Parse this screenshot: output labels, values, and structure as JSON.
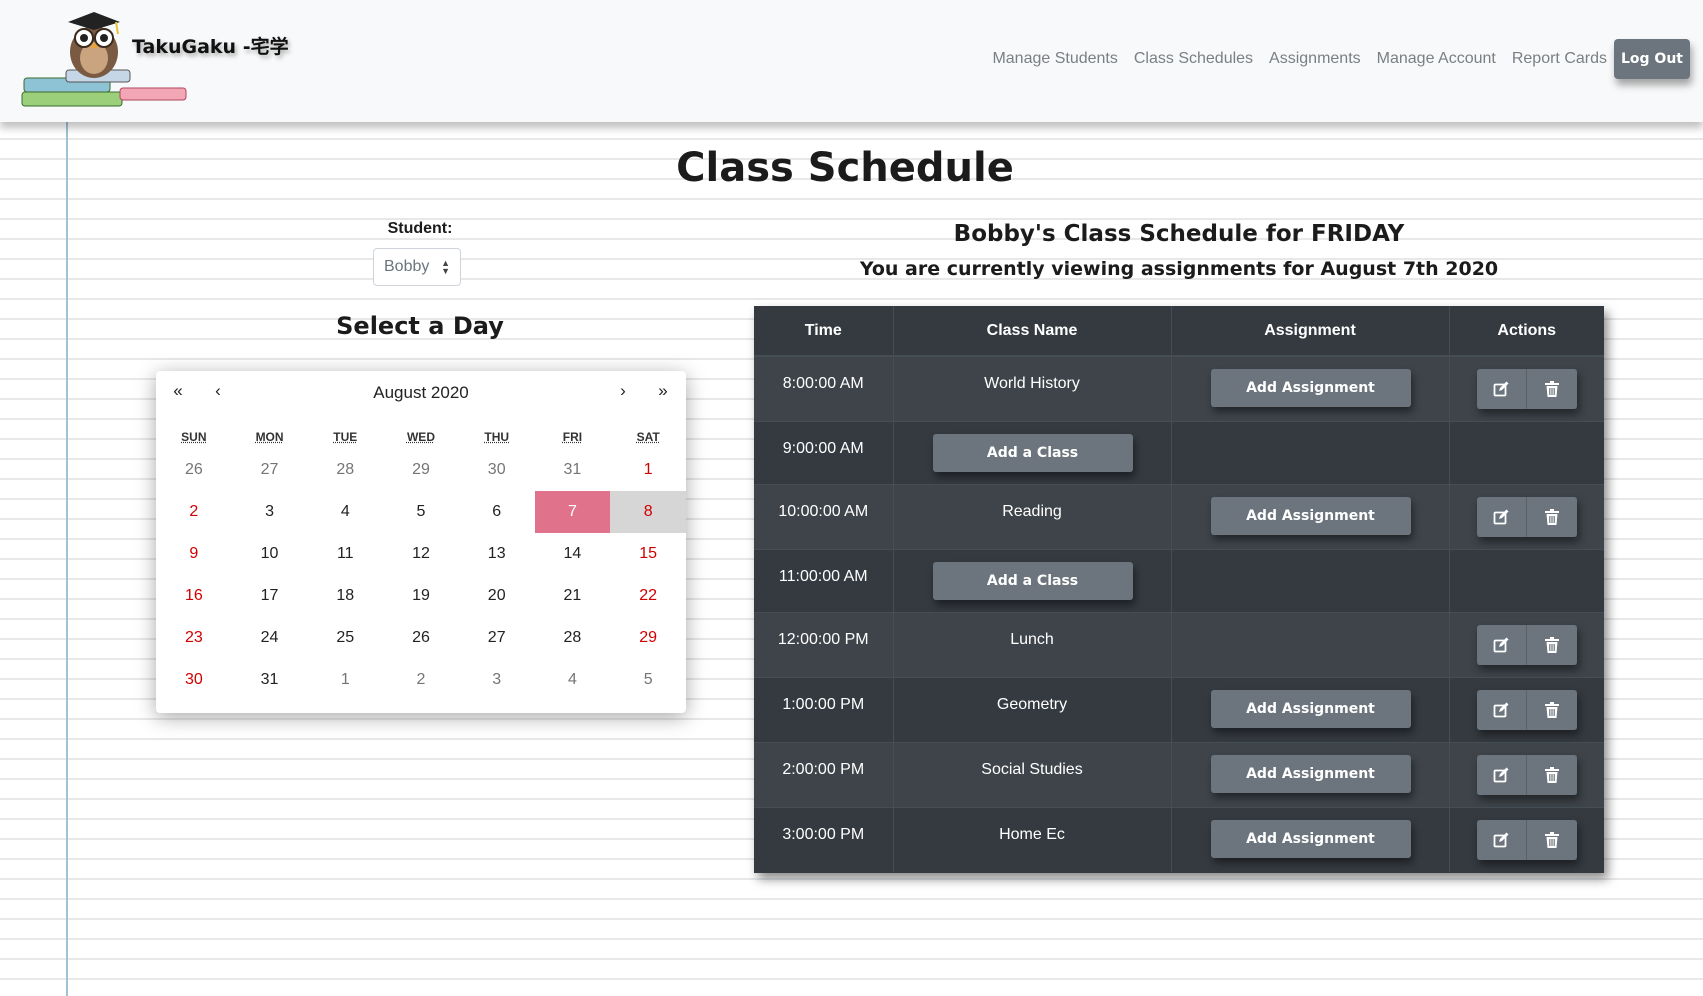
{
  "brand": {
    "name": "TakuGaku -宅学",
    "logo_alt": "owl-on-books-logo"
  },
  "nav": {
    "links": [
      "Manage Students",
      "Class Schedules",
      "Assignments",
      "Manage Account",
      "Report Cards"
    ],
    "logout": "Log Out"
  },
  "page": {
    "title": "Class Schedule",
    "student_label": "Student:",
    "student_selected": "Bobby",
    "select_day": "Select a Day",
    "schedule_heading": "Bobby's Class Schedule for FRIDAY",
    "schedule_subheading": "You are currently viewing assignments for August 7th 2020"
  },
  "calendar": {
    "nav": {
      "prev_year": "«",
      "prev_month": "‹",
      "next_month": "›",
      "next_year": "»"
    },
    "month_label": "August 2020",
    "weekdays": [
      "SUN",
      "MON",
      "TUE",
      "WED",
      "THU",
      "FRI",
      "SAT"
    ],
    "weeks": [
      [
        "26",
        "27",
        "28",
        "29",
        "30",
        "31",
        "1"
      ],
      [
        "2",
        "3",
        "4",
        "5",
        "6",
        "7",
        "8"
      ],
      [
        "9",
        "10",
        "11",
        "12",
        "13",
        "14",
        "15"
      ],
      [
        "16",
        "17",
        "18",
        "19",
        "20",
        "21",
        "22"
      ],
      [
        "23",
        "24",
        "25",
        "26",
        "27",
        "28",
        "29"
      ],
      [
        "30",
        "31",
        "1",
        "2",
        "3",
        "4",
        "5"
      ]
    ],
    "selected_day": "7",
    "colors": {
      "selected": "#e0728c",
      "weekend": "#d10000",
      "highlight": "#d6d6d6"
    }
  },
  "table": {
    "headers": [
      "Time",
      "Class Name",
      "Assignment",
      "Actions"
    ],
    "rows": [
      {
        "time": "8:00:00 AM",
        "class": "World History",
        "assignment_button": "Add Assignment",
        "actions": true
      },
      {
        "time": "9:00:00 AM",
        "class_button": "Add a Class"
      },
      {
        "time": "10:00:00 AM",
        "class": "Reading",
        "assignment_button": "Add Assignment",
        "actions": true
      },
      {
        "time": "11:00:00 AM",
        "class_button": "Add a Class"
      },
      {
        "time": "12:00:00 PM",
        "class": "Lunch",
        "actions": true
      },
      {
        "time": "1:00:00 PM",
        "class": "Geometry",
        "assignment_button": "Add Assignment",
        "actions": true
      },
      {
        "time": "2:00:00 PM",
        "class": "Social Studies",
        "assignment_button": "Add Assignment",
        "actions": true
      },
      {
        "time": "3:00:00 PM",
        "class": "Home Ec",
        "assignment_button": "Add Assignment",
        "actions": true
      }
    ],
    "action_icons": [
      "edit-icon",
      "trash-icon"
    ]
  }
}
